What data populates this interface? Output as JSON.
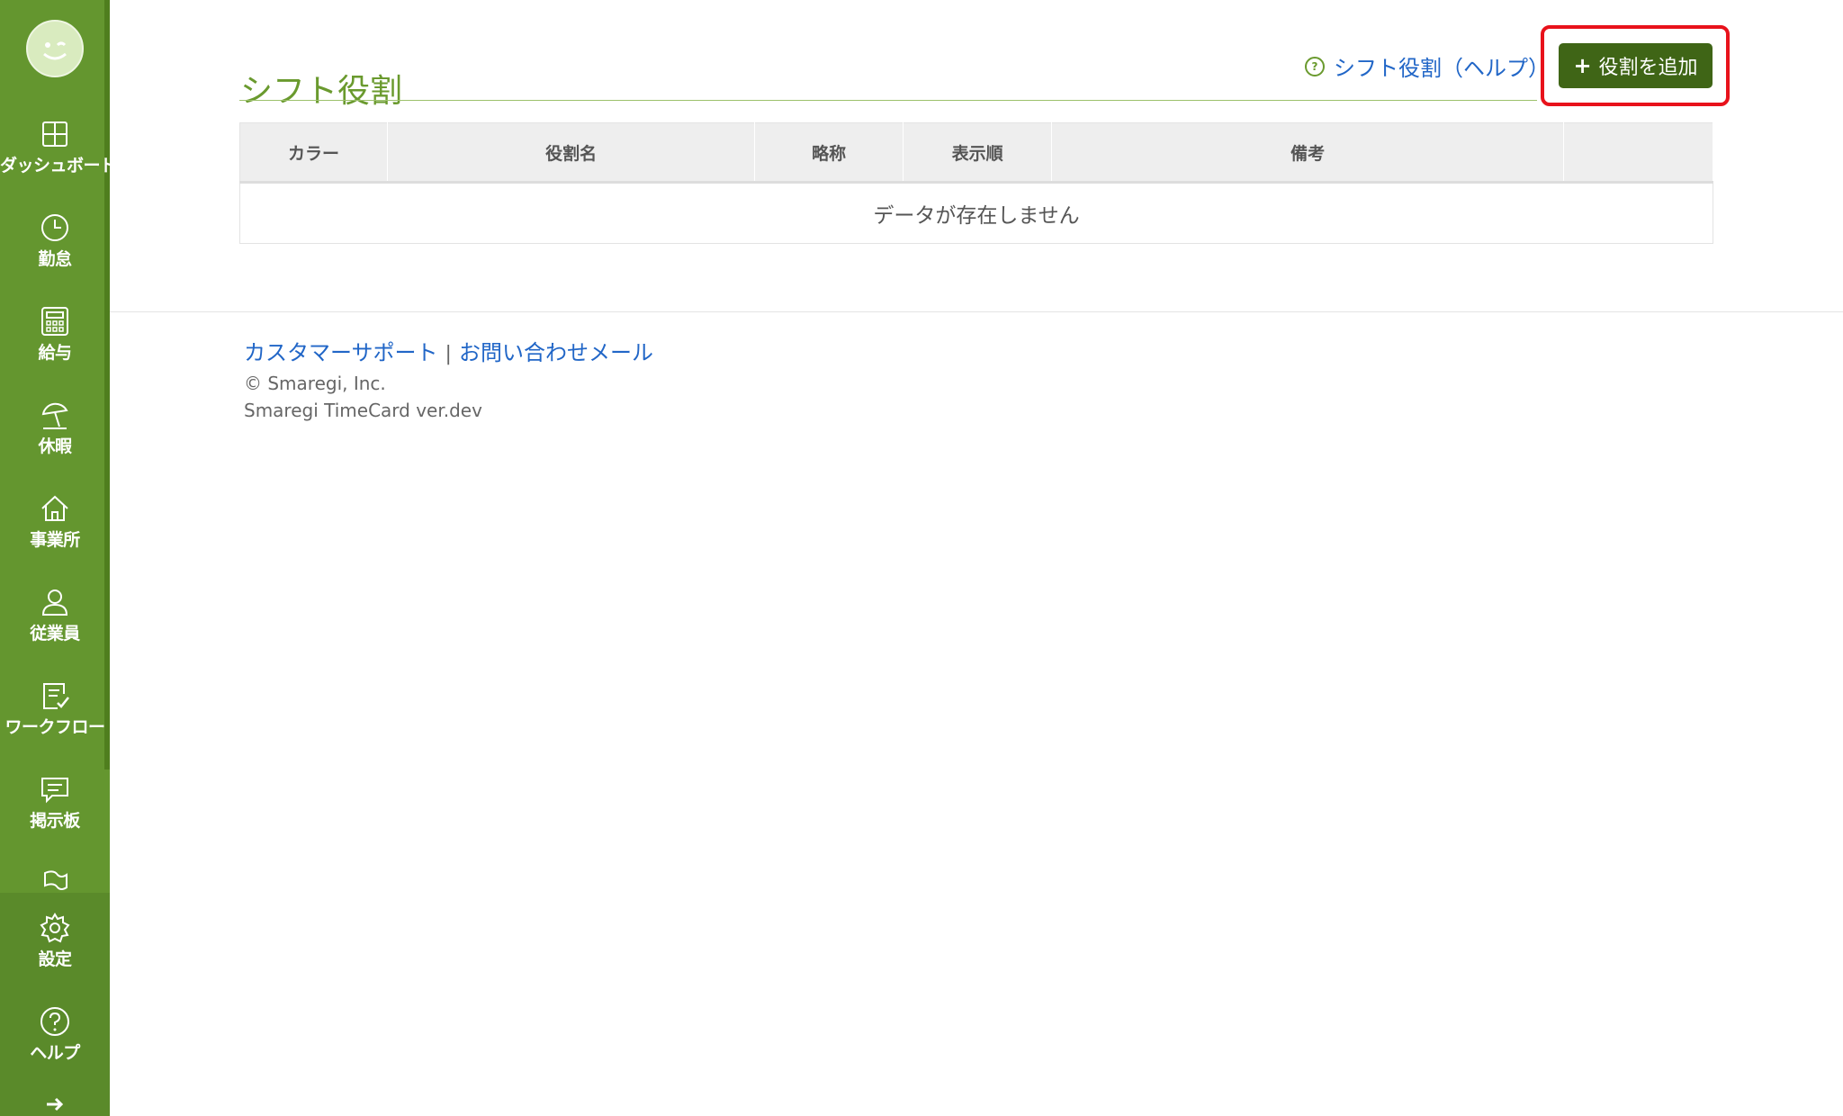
{
  "sidebar": {
    "items": [
      {
        "label": "ダッシュボード",
        "icon": "dashboard-icon"
      },
      {
        "label": "勤怠",
        "icon": "clock-icon"
      },
      {
        "label": "給与",
        "icon": "calculator-icon"
      },
      {
        "label": "休暇",
        "icon": "beach-umbrella-icon"
      },
      {
        "label": "事業所",
        "icon": "home-icon"
      },
      {
        "label": "従業員",
        "icon": "person-icon"
      },
      {
        "label": "ワークフロー",
        "icon": "checklist-icon"
      },
      {
        "label": "掲示板",
        "icon": "chat-icon"
      }
    ],
    "bottom_items": [
      {
        "label": "設定",
        "icon": "gear-icon"
      },
      {
        "label": "ヘルプ",
        "icon": "help-icon"
      }
    ]
  },
  "page": {
    "title": "シフト役割",
    "help_link": "シフト役割（ヘルプ）",
    "add_button": "役割を追加"
  },
  "table": {
    "columns": [
      "カラー",
      "役割名",
      "略称",
      "表示順",
      "備考",
      ""
    ],
    "empty_message": "データが存在しません"
  },
  "footer": {
    "support_link": "カスタマーサポート",
    "separator": "|",
    "contact_link": "お問い合わせメール",
    "copyright": "© Smaregi, Inc.",
    "version": "Smaregi TimeCard ver.dev"
  },
  "colors": {
    "sidebar": "#64962f",
    "accent": "#6a9a2e",
    "button": "#3f6516",
    "link": "#2166c7",
    "highlight": "#e8121b"
  }
}
